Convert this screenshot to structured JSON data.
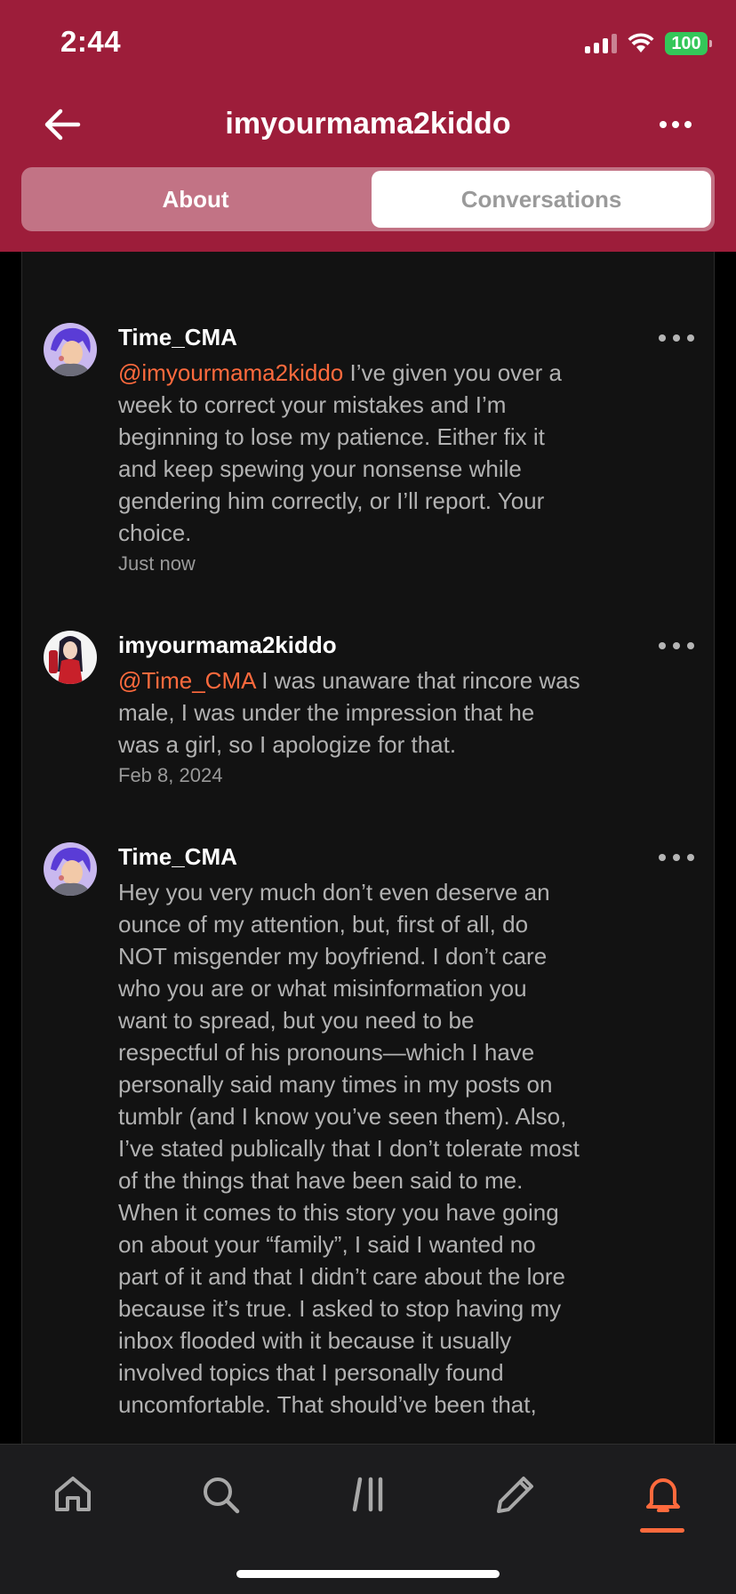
{
  "status_bar": {
    "time": "2:44",
    "battery": "100"
  },
  "header": {
    "title": "imyourmama2kiddo"
  },
  "tabs": [
    {
      "label": "About",
      "selected": false
    },
    {
      "label": "Conversations",
      "selected": true
    }
  ],
  "posts": [
    {
      "author": "Time_CMA",
      "mention": "@imyourmama2kiddo",
      "text": " I’ve given you over a week to correct your mistakes and I’m beginning to lose my patience. Either fix it and keep spewing your nonsense while gendering him correctly, or I’ll report. Your choice.",
      "time": "Just now"
    },
    {
      "author": "imyourmama2kiddo",
      "mention": "@Time_CMA",
      "text": "  I was unaware that rincore was male, I was under the impression that he was a girl, so I apologize for that.",
      "time": "Feb 8, 2024"
    },
    {
      "author": "Time_CMA",
      "mention": "",
      "text": "Hey you very much don’t even deserve an ounce of my attention, but, first of all, do NOT misgender my boyfriend. I don’t care who you are or what misinformation you want to spread, but you need to be respectful of his pronouns—which I have personally said many times in my posts on tumblr (and I know you’ve seen them). Also, I’ve stated publically that I don’t tolerate most of the things that have been said to me. When it comes to this story you have going on about your “family”, I said I wanted no part of it and that I didn’t care about the lore because it’s true. I asked to stop having my inbox flooded with it because it usually involved topics that I personally found uncomfortable. That should’ve been that,",
      "time": ""
    }
  ],
  "bottom_nav": [
    "home-icon",
    "search-icon",
    "feed-icon",
    "pencil-icon",
    "bell-icon"
  ],
  "colors": {
    "header": "#9d1d3a",
    "accent": "#ff6a3d",
    "background": "#121212"
  }
}
